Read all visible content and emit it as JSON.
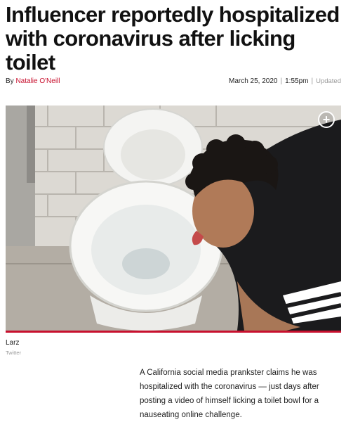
{
  "article": {
    "headline": "Influencer reportedly hospitalized with coronavirus after licking toilet",
    "byline_prefix": "By",
    "author": "Natalie O'Neill",
    "date": "March 25, 2020",
    "time": "1:55pm",
    "updated_label": "Updated",
    "separator": "|"
  },
  "image": {
    "expand_icon": "plus-circle-icon",
    "caption": "Larz",
    "credit": "Twitter"
  },
  "lede": "A California social media prankster claims he was hospitalized with the coronavirus — just days after posting a video of himself licking a toilet bowl for a nauseating online challenge.",
  "colors": {
    "accent_red": "#c8102e",
    "muted_gray": "#999999"
  }
}
